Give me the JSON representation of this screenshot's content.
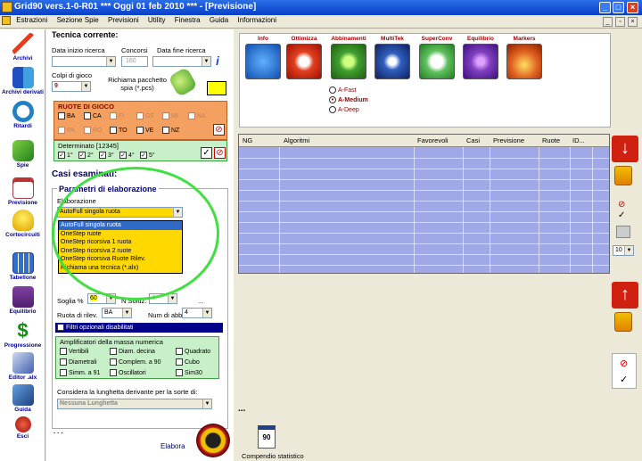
{
  "window": {
    "title": "Grid90 vers.1-0-R01  ***  Oggi 01 feb 2010  ***  - [Previsione]"
  },
  "menu": [
    "Estrazioni",
    "Sezione Spie",
    "Previsioni",
    "Utility",
    "Finestra",
    "Guida",
    "Informazioni"
  ],
  "sidebar": [
    {
      "label": "Archivi",
      "icon": "pencil-icon"
    },
    {
      "label": "Archivi derivati",
      "icon": "books-icon"
    },
    {
      "label": "Ritardi",
      "icon": "clock-icon"
    },
    {
      "label": "Spie",
      "icon": "flashlight-icon"
    },
    {
      "label": "Previsione",
      "icon": "checklist-icon"
    },
    {
      "label": "Cortocircuiti",
      "icon": "lightbulb-icon"
    },
    {
      "label": "Tabellone",
      "icon": "calendar-icon"
    },
    {
      "label": "Equilibrio",
      "icon": "scales-icon"
    },
    {
      "label": "Progressione",
      "icon": "dollar-icon"
    },
    {
      "label": "Editor .alx",
      "icon": "editor-icon"
    },
    {
      "label": "Guida",
      "icon": "guide-icon"
    },
    {
      "label": "Esci",
      "icon": "exit-icon"
    }
  ],
  "left": {
    "tecnica_corrente": "Tecnica corrente:",
    "data_inizio": "Data inizio ricerca",
    "concorsi": "Concorsi",
    "concorsi_value": "160",
    "data_fine": "Data fine ricerca",
    "colpi": "Colpi di gioco",
    "colpi_value": "9",
    "richiama": "Richiama pacchetto spia (*.pcs)",
    "ruote_header": "RUOTE DI GIOCO",
    "ruote_row1": [
      "BA",
      "CA",
      "FI",
      "GE",
      "MI",
      "NA"
    ],
    "ruote_row2": [
      "PA",
      "RO",
      "TO",
      "VE",
      "NZ"
    ],
    "determinato": "Determinato [12345]",
    "determinato_items": [
      "1°",
      "2°",
      "3°",
      "4°",
      "5°"
    ],
    "casi_esaminati": "Casi esaminati:",
    "parametri": "Parametri di elaborazione",
    "elaborazione": "Elaborazione",
    "elaborazione_value": "AutoFull singola ruota",
    "dropdown_options": [
      "AutoFull singola ruota",
      "OneStep ruote",
      "OneStep ricorsiva 1 ruota",
      "OneStep ricorsiva 2 ruote",
      "OneStep ricorsiva Ruote Rilev.",
      "Richiama una tecnica (*.alx)"
    ],
    "soglia": "Soglia %",
    "soglia_value": "60",
    "nsoluz": "N Soluz.",
    "nsoluz_value": "4",
    "ruota_rilev": "Ruota di rilev.",
    "ruota_rilev_value": "BA",
    "num_abb": "Num di abb.",
    "num_abb_value": "4",
    "filtri": "Filtri opzionali disabilitati",
    "amplificatori": "Amplificatori della massa numerica",
    "amp_items": [
      "Vertibili",
      "Diam. decina",
      "Quadrato",
      "Diametrali",
      "Complem. a 90",
      "Cubo",
      "Simm. a 91",
      "Oscillatori",
      "Sim30"
    ],
    "lunghetta": "Considera la lunghetta derivante per la sorte di:",
    "lunghetta_value": "Nessuna Lunghetta",
    "dots": ". . .",
    "elabora": "Elabora",
    "ellipsis": "..."
  },
  "right": {
    "features": [
      {
        "label": "Info",
        "color": "#2a7ad8",
        "icon": "question-icon"
      },
      {
        "label": "Ottimizza",
        "color": "#e04020",
        "icon": "flame-icon"
      },
      {
        "label": "Abbinamenti",
        "color": "#40a030",
        "icon": "gear-icon"
      },
      {
        "label": "MultiTek",
        "color": "#3060c0",
        "icon": "swirl-icon"
      },
      {
        "label": "SuperConv",
        "color": "#40b040",
        "icon": "recycle-icon"
      },
      {
        "label": "Equilibrio",
        "color": "#8040c0",
        "icon": "purple-icon"
      },
      {
        "label": "Markers",
        "color": "#e06020",
        "icon": "sphere-icon"
      }
    ],
    "modes": [
      "A-Fast",
      "A-Medium",
      "A-Deep"
    ],
    "selected_mode": "A-Medium",
    "columns": [
      "NG",
      "Algoritmi",
      "Favorevoli",
      "Casi",
      "Previsione",
      "Ruote",
      "ID..."
    ],
    "dots": "...",
    "compendio": "Compendio statistico",
    "calendar_number": "90",
    "side_select": "10"
  }
}
